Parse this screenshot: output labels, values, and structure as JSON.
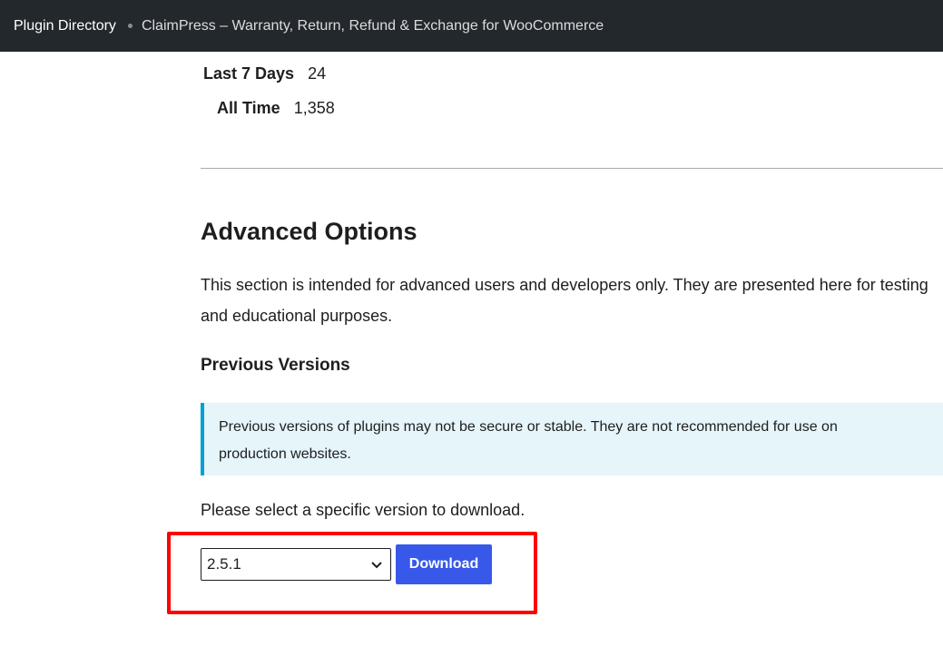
{
  "breadcrumb": {
    "root": "Plugin Directory",
    "current": "ClaimPress – Warranty, Return, Refund & Exchange for WooCommerce"
  },
  "stats": [
    {
      "label": "Last 7 Days",
      "value": "24"
    },
    {
      "label": "All Time",
      "value": "1,358"
    }
  ],
  "advanced": {
    "title": "Advanced Options",
    "description": "This section is intended for advanced users and developers only. They are presented here for testing and educational purposes.",
    "previous_versions_title": "Previous Versions",
    "notice": "Previous versions of plugins may not be secure or stable. They are not recommended for use on production websites.",
    "select_prompt": "Please select a specific version to download.",
    "selected_version": "2.5.1",
    "download_label": "Download"
  },
  "colors": {
    "topbar": "#23282d",
    "notice_bg": "#e5f5fa",
    "notice_border": "#00a0d2",
    "button": "#3858e9",
    "highlight": "#ff0000"
  }
}
